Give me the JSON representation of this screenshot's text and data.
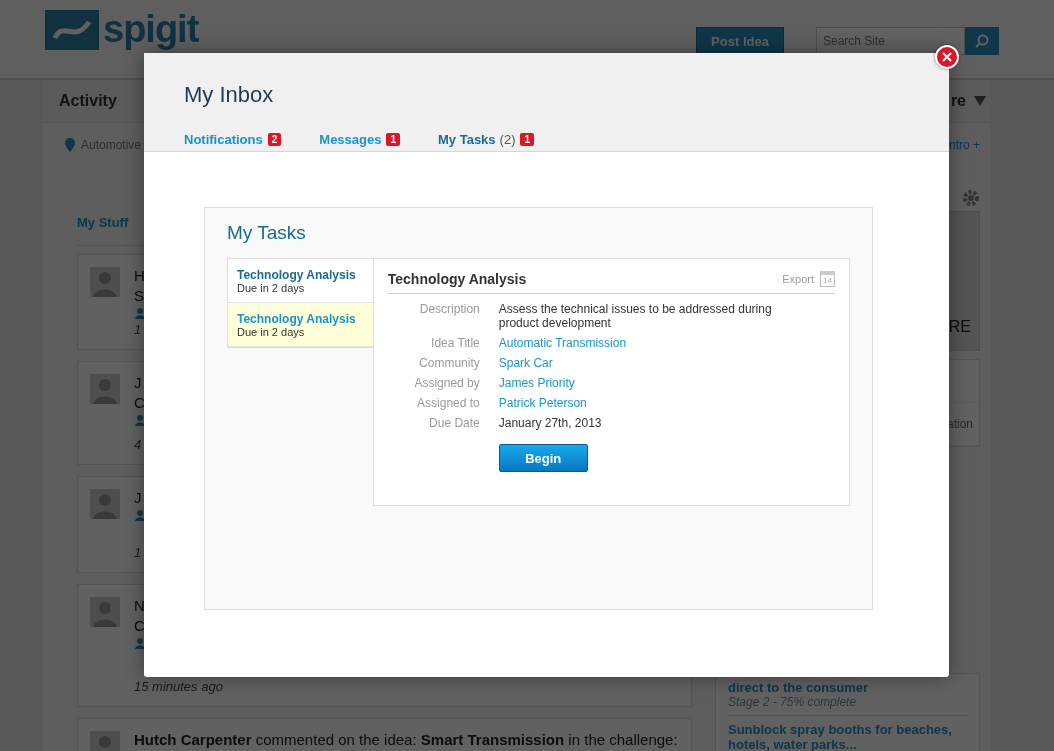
{
  "header": {
    "logo": "spigit",
    "post_button": "Post Idea",
    "search_placeholder": "Search Site"
  },
  "nav": {
    "left": "Activity",
    "right": "re"
  },
  "filter": {
    "location": "Automotive",
    "right_link": "ntro +"
  },
  "feed": {
    "heading": "My Stuff",
    "items": [
      {
        "lines": [
          "H",
          "S"
        ],
        "time": "1"
      },
      {
        "lines": [
          "J",
          "C"
        ],
        "time": "4"
      },
      {
        "lines": [
          "J"
        ],
        "time": "1"
      },
      {
        "lines": [
          "N",
          "C"
        ],
        "time": "15 minutes ago"
      },
      {
        "lines": [
          "**Hutch Carpenter** commented on the idea: **Smart Transmission** in the challenge:"
        ]
      }
    ]
  },
  "sidebar": {
    "banner_text": "RE",
    "rows": [
      "",
      "ation"
    ],
    "ideas": [
      {
        "title": "direct to the consumer",
        "stage": "Stage 2 - 75% complete"
      },
      {
        "title": "Sunblock spray booths for beaches, hotels, water parks..."
      }
    ]
  },
  "modal": {
    "title": "My Inbox",
    "tabs": [
      {
        "label": "Notifications",
        "badge": "2",
        "selected": false
      },
      {
        "label": "Messages",
        "badge": "1",
        "selected": false
      },
      {
        "label": "My Tasks",
        "count": "(2)",
        "badge": "1",
        "selected": true
      }
    ],
    "panel_title": "My Tasks",
    "tasks": [
      {
        "title": "Technology Analysis",
        "due": "Due in 2 days",
        "selected": false
      },
      {
        "title": "Technology Analysis",
        "due": "Due in 2 days",
        "selected": true
      }
    ],
    "detail": {
      "title": "Technology Analysis",
      "export": "Export",
      "calendar_day": "14",
      "fields": [
        {
          "label": "Description",
          "value": "Assess the technical issues to be addressed during product development",
          "kind": "text"
        },
        {
          "label": "Idea Title",
          "value": "Automatic Transmission",
          "kind": "link"
        },
        {
          "label": "Community",
          "value": "Spark Car",
          "kind": "link"
        },
        {
          "label": "Assigned by",
          "value": "James Priority",
          "kind": "link"
        },
        {
          "label": "Assigned to",
          "value": "Patrick Peterson",
          "kind": "link"
        },
        {
          "label": "Due Date",
          "value": "January 27th, 2013",
          "kind": "text"
        }
      ],
      "button": "Begin"
    }
  }
}
